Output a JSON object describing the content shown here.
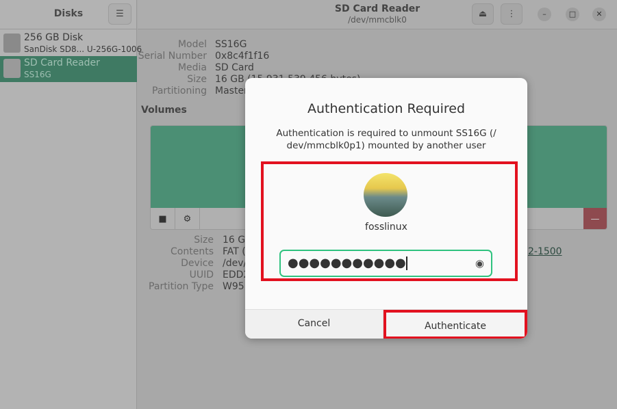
{
  "sidebar": {
    "title": "Disks",
    "menu_icon": "hamburger-icon",
    "disks": [
      {
        "name": "256 GB Disk",
        "sub": "SanDisk SD8...  U-256G-1006",
        "selected": false
      },
      {
        "name": "SD Card Reader",
        "sub": "SS16G",
        "selected": true
      }
    ]
  },
  "header": {
    "title": "SD Card Reader",
    "subtitle": "/dev/mmcblk0",
    "eject_icon": "eject-icon",
    "more_icon": "kebab-menu-icon",
    "window_controls": [
      "minimize",
      "maximize",
      "close"
    ]
  },
  "drive": {
    "labels": [
      "Model",
      "Serial Number",
      "Media",
      "Size",
      "Partitioning"
    ],
    "values": [
      "SS16G",
      "0x8c4f1f16",
      "SD Card",
      "16 GB (15,931,539,456 bytes)",
      "Master Boot Record"
    ]
  },
  "volumes": {
    "title": "Volumes",
    "labels": [
      "Size",
      "Contents",
      "Device",
      "UUID",
      "Partition Type"
    ],
    "values": [
      "16 GB",
      "FAT (",
      "/dev/",
      "EDD2",
      "W95"
    ],
    "link_fragment": "2-1500",
    "colors": {
      "volume": "#4b8f74",
      "delete": "#8e4a4f"
    }
  },
  "dialog": {
    "title": "Authentication Required",
    "message": "Authentication is required to unmount SS16G (/ dev/mmcblk0p1) mounted by another user",
    "user": "fosslinux",
    "password_masked": "●●●●●●●●●●●",
    "cancel": "Cancel",
    "authenticate": "Authenticate",
    "highlight_color": "#e2111f",
    "focus_color": "#2ec27e"
  }
}
